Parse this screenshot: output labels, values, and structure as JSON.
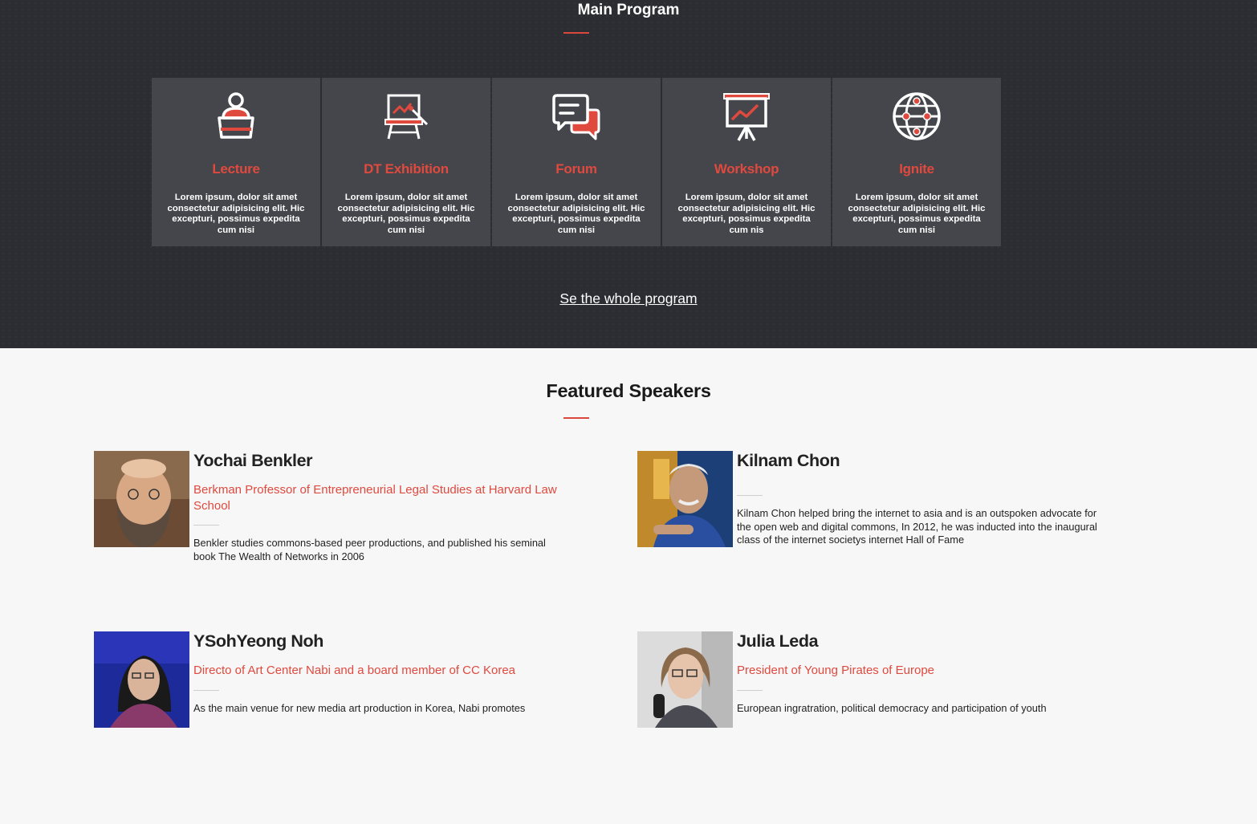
{
  "program": {
    "title": "Main Program",
    "cards": [
      {
        "icon": "lecture-icon",
        "title": "Lecture",
        "text": "Lorem ipsum, dolor sit amet consectetur adipisicing elit. Hic excepturi, possimus expedita cum nisi"
      },
      {
        "icon": "easel-icon",
        "title": "DT Exhibition",
        "text": "Lorem ipsum, dolor sit amet consectetur adipisicing elit. Hic excepturi, possimus expedita cum nisi"
      },
      {
        "icon": "chat-bubbles-icon",
        "title": "Forum",
        "text": "Lorem ipsum, dolor sit amet consectetur adipisicing elit. Hic excepturi, possimus expedita cum nisi"
      },
      {
        "icon": "presentation-chart-icon",
        "title": "Workshop",
        "text": "Lorem ipsum, dolor sit amet consectetur adipisicing elit. Hic excepturi, possimus expedita cum nis"
      },
      {
        "icon": "globe-network-icon",
        "title": "Ignite",
        "text": "Lorem ipsum, dolor sit amet consectetur adipisicing elit. Hic excepturi, possimus expedita cum nisi"
      }
    ],
    "link_label": "Se the whole program"
  },
  "speakers": {
    "title": "Featured Speakers",
    "items": [
      {
        "name": "Yochai Benkler",
        "role": "Berkman Professor of Entrepreneurial Legal Studies at Harvard Law School",
        "bio": "Benkler studies commons-based peer productions, and published his seminal book The Wealth of Networks in 2006"
      },
      {
        "name": "Kilnam Chon",
        "role": "",
        "bio": "Kilnam Chon helped bring the internet to asia and is an outspoken advocate for the open web and digital commons, In 2012, he was inducted into the inaugural class of the internet societys internet Hall of Fame"
      },
      {
        "name": "YSohYeong Noh",
        "role": "Directo of Art Center Nabi and a board member of CC Korea",
        "bio": "As the main venue for new media art production in Korea, Nabi promotes"
      },
      {
        "name": "Julia Leda",
        "role": "President of Young Pirates of Europe",
        "bio": "European ingratration, political democracy and participation of youth"
      }
    ]
  },
  "colors": {
    "accent": "#e0493e",
    "dark_bg": "#2b2d33",
    "card_bg": "#45464b",
    "light_bg": "#f7f7f7"
  }
}
